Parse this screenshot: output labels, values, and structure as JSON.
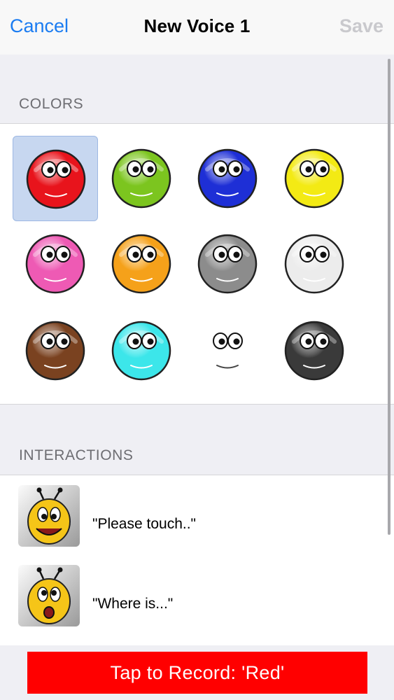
{
  "nav": {
    "cancel": "Cancel",
    "title": "New Voice 1",
    "save": "Save"
  },
  "sections": {
    "colors": "COLORS",
    "interactions": "INTERACTIONS"
  },
  "colors": [
    {
      "name": "red",
      "fill": "#e8141c",
      "selected": true
    },
    {
      "name": "green",
      "fill": "#7cc51f"
    },
    {
      "name": "blue",
      "fill": "#1e2fd6"
    },
    {
      "name": "yellow",
      "fill": "#f3ea14"
    },
    {
      "name": "pink",
      "fill": "#ee5ab4"
    },
    {
      "name": "orange",
      "fill": "#f5a11a"
    },
    {
      "name": "gray",
      "fill": "#8c8c8c"
    },
    {
      "name": "white",
      "fill": "#ececec"
    },
    {
      "name": "brown",
      "fill": "#7a4220"
    },
    {
      "name": "cyan",
      "fill": "#3ce6ea"
    },
    {
      "name": "transparent",
      "fill": "none"
    },
    {
      "name": "black",
      "fill": "#3a3a3a"
    }
  ],
  "interactions": [
    {
      "label": "\"Please touch..\"",
      "icon": "bee-smile-icon"
    },
    {
      "label": "\"Where is...\"",
      "icon": "bee-surprised-icon"
    }
  ],
  "record": {
    "label": "Tap to Record: 'Red'",
    "color": "#ff0000"
  }
}
